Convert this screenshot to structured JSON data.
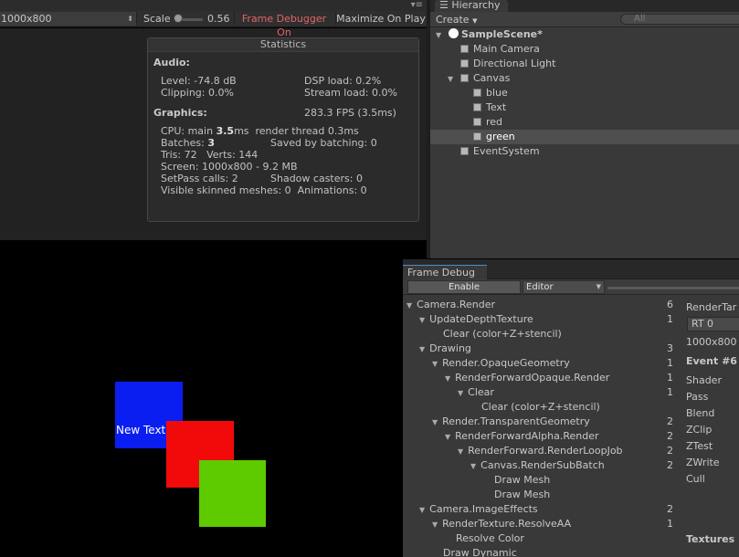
{
  "game_view": {
    "resolution": "1000x800",
    "scale_label": "Scale",
    "scale_value": "0.56",
    "frame_debugger_label": "Frame Debugger On",
    "maximize_label": "Maximize On Play",
    "statistics": {
      "title": "Statistics",
      "audio_heading": "Audio:",
      "level": "Level: -74.8 dB",
      "clipping": "Clipping: 0.0%",
      "dsp_load": "DSP load: 0.2%",
      "stream_load": "Stream load: 0.0%",
      "graphics_heading": "Graphics:",
      "fps": "283.3 FPS (3.5ms)",
      "cpu_prefix": "CPU: main ",
      "cpu_main": "3.5",
      "cpu_suffix": "ms  render thread 0.3ms",
      "batches_prefix": "Batches: ",
      "batches_value": "3",
      "saved_by_batching": "Saved by batching: 0",
      "tris_verts": "Tris: 72   Verts: 144",
      "screen": "Screen: 1000x800 - 9.2 MB",
      "setpass": "SetPass calls: 2",
      "shadow_casters": "Shadow casters: 0",
      "skinned_animations": "Visible skinned meshes: 0  Animations: 0"
    },
    "scene": {
      "new_text": "New Text",
      "colors": {
        "blue": "#0a1ef2",
        "red": "#f20a0a",
        "green": "#5ecb00"
      }
    }
  },
  "hierarchy": {
    "tab_label": "Hierarchy",
    "create_label": "Create",
    "search_placeholder": "All",
    "scene_name": "SampleScene*",
    "items": [
      {
        "label": "Main Camera"
      },
      {
        "label": "Directional Light"
      },
      {
        "label": "Canvas"
      },
      {
        "label": "blue"
      },
      {
        "label": "Text"
      },
      {
        "label": "red"
      },
      {
        "label": "green",
        "selected": true
      },
      {
        "label": "EventSystem"
      }
    ]
  },
  "frame_debug": {
    "tab_label": "Frame Debug",
    "enable_label": "Enable",
    "mode_value": "Editor",
    "events": [
      {
        "label": "Camera.Render",
        "count": "6"
      },
      {
        "label": "UpdateDepthTexture",
        "count": "1"
      },
      {
        "label": "Clear (color+Z+stencil)",
        "count": ""
      },
      {
        "label": "Drawing",
        "count": "3"
      },
      {
        "label": "Render.OpaqueGeometry",
        "count": "1"
      },
      {
        "label": "RenderForwardOpaque.Render",
        "count": "1"
      },
      {
        "label": "Clear",
        "count": "1"
      },
      {
        "label": "Clear (color+Z+stencil)",
        "count": ""
      },
      {
        "label": "Render.TransparentGeometry",
        "count": "2"
      },
      {
        "label": "RenderForwardAlpha.Render",
        "count": "2"
      },
      {
        "label": "RenderForward.RenderLoopJob",
        "count": "2"
      },
      {
        "label": "Canvas.RenderSubBatch",
        "count": "2"
      },
      {
        "label": "Draw Mesh",
        "count": ""
      },
      {
        "label": "Draw Mesh",
        "count": ""
      },
      {
        "label": "Camera.ImageEffects",
        "count": "2"
      },
      {
        "label": "RenderTexture.ResolveAA",
        "count": "1"
      },
      {
        "label": "Resolve Color",
        "count": ""
      },
      {
        "label": "Draw Dynamic",
        "count": ""
      }
    ],
    "detail": {
      "render_target": "RenderTar",
      "rt_value": "RT 0",
      "size": "1000x800",
      "event": "Event #6",
      "props": [
        "Shader",
        "Pass",
        "Blend",
        "ZClip",
        "ZTest",
        "ZWrite",
        "Cull"
      ],
      "textures": "Textures"
    }
  }
}
